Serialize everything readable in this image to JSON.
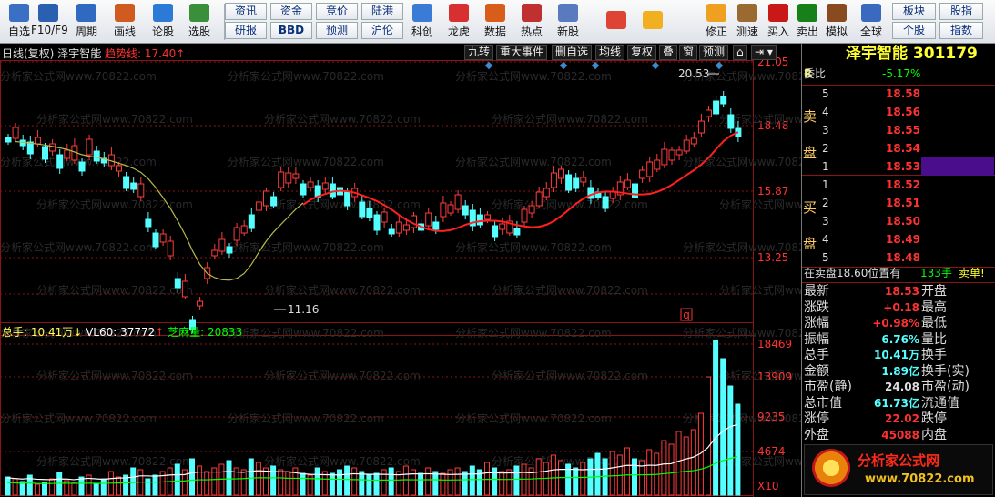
{
  "toolbar": {
    "row_buttons": [
      {
        "label": "自选",
        "name": "zixuan"
      },
      {
        "label": "F10/F9",
        "name": "f10"
      },
      {
        "label": "周期",
        "name": "period"
      },
      {
        "label": "画线",
        "name": "draw-line"
      },
      {
        "label": "论股",
        "name": "lungu"
      },
      {
        "label": "选股",
        "name": "xuangu"
      }
    ],
    "text_buttons": [
      {
        "label": "资讯",
        "name": "zixun"
      },
      {
        "label": "资金",
        "name": "zijin"
      },
      {
        "label": "竞价",
        "name": "jingjia"
      },
      {
        "label": "陆港",
        "name": "lugang"
      },
      {
        "label": "研报",
        "name": "yanbao"
      },
      {
        "label": "BBD",
        "name": "bbd"
      },
      {
        "label": "预测",
        "name": "yuce"
      },
      {
        "label": "沪伦",
        "name": "hulun"
      }
    ],
    "tool_buttons": [
      {
        "label": "科创",
        "name": "kechuang"
      },
      {
        "label": "龙虎",
        "name": "longhu"
      },
      {
        "label": "数据",
        "name": "shuju"
      },
      {
        "label": "热点",
        "name": "redian"
      },
      {
        "label": "新股",
        "name": "xingu"
      }
    ],
    "right_buttons": [
      {
        "label": "修正",
        "name": "xiuzheng"
      },
      {
        "label": "测速",
        "name": "cesu"
      },
      {
        "label": "买入",
        "name": "buy"
      },
      {
        "label": "卖出",
        "name": "sell"
      },
      {
        "label": "模拟",
        "name": "moni"
      },
      {
        "label": "全球",
        "name": "quanqiu"
      }
    ],
    "far_buttons": [
      {
        "label": "板块",
        "name": "bankuai"
      },
      {
        "label": "股指",
        "name": "guzhi"
      },
      {
        "label": "个股",
        "name": "gegu"
      },
      {
        "label": "指数",
        "name": "zhishu"
      }
    ]
  },
  "chart": {
    "period_label": "日线(复权)",
    "stock_name": "泽宇智能",
    "trend_label": "趋势线: 17.40",
    "trend_arrow": "↑",
    "tabs": [
      "九转",
      "重大事件",
      "删自选",
      "均线",
      "复权",
      "叠",
      "窗",
      "预测"
    ],
    "price_axis": [
      "21.05",
      "18.48",
      "15.87",
      "13.25"
    ],
    "high_label": "20.53",
    "low_label": "11.16",
    "watermark": "分析家公式网www.70822.com",
    "vol_title": {
      "total": "总手: 10.41万",
      "total_arrow": "↓",
      "vl60": "VL60: 37772",
      "vl60_arrow": "↑",
      "zhima": "芝麻量: 20833"
    },
    "vol_axis": [
      "18469",
      "13909",
      "9235",
      "4674"
    ],
    "x10": "X10",
    "q_mark": "q",
    "colors": {
      "up": "#ff3c3c",
      "down": "#54ffff",
      "ma_red": "#ff2020",
      "ma_olive": "#b8b84a",
      "grid": "#8a1414",
      "text_red": "#ff3232",
      "text_yellow": "#ffff55",
      "text_green": "#00ff00"
    }
  },
  "chart_data": {
    "type": "table",
    "candles_note": "",
    "price_range": [
      11.16,
      20.53
    ]
  },
  "panel": {
    "title": "泽宇智能 301179",
    "r": "R",
    "weibi_label": "委比",
    "weibi": "-5.17%",
    "sell_label": "卖盘",
    "buy_label": "买盘",
    "asks": [
      {
        "lvl": "5",
        "price": "18.58"
      },
      {
        "lvl": "4",
        "price": "18.56"
      },
      {
        "lvl": "3",
        "price": "18.55"
      },
      {
        "lvl": "2",
        "price": "18.54"
      },
      {
        "lvl": "1",
        "price": "18.53"
      }
    ],
    "bids": [
      {
        "lvl": "1",
        "price": "18.52"
      },
      {
        "lvl": "2",
        "price": "18.51"
      },
      {
        "lvl": "3",
        "price": "18.50"
      },
      {
        "lvl": "4",
        "price": "18.49"
      },
      {
        "lvl": "5",
        "price": "18.48"
      }
    ],
    "info": {
      "pre": "在卖盘18.60位置有",
      "qty": "133手",
      "suf": "卖单!"
    },
    "stats": [
      {
        "k1": "最新",
        "v1": "18.53",
        "c1": "#ff3232",
        "k2": "开盘"
      },
      {
        "k1": "涨跌",
        "v1": "+0.18",
        "c1": "#ff3232",
        "k2": "最高"
      },
      {
        "k1": "涨幅",
        "v1": "+0.98%",
        "c1": "#ff3232",
        "k2": "最低"
      },
      {
        "k1": "振幅",
        "v1": "6.76%",
        "c1": "#54ffff",
        "k2": "量比"
      },
      {
        "k1": "总手",
        "v1": "10.41万",
        "c1": "#54ffff",
        "k2": "换手"
      },
      {
        "k1": "金额",
        "v1": "1.89亿",
        "c1": "#54ffff",
        "k2": "换手(实)"
      },
      {
        "k1": "市盈(静)",
        "v1": "24.08",
        "c1": "#dddddd",
        "k2": "市盈(动)"
      },
      {
        "k1": "总市值",
        "v1": "61.73亿",
        "c1": "#54ffff",
        "k2": "流通值"
      },
      {
        "k1": "涨停",
        "v1": "22.02",
        "c1": "#ff3232",
        "k2": "跌停"
      },
      {
        "k1": "外盘",
        "v1": "45088",
        "c1": "#ff3232",
        "k2": "内盘"
      }
    ],
    "logo_text": "分析家公式网",
    "logo_url": "www.70822.com"
  }
}
